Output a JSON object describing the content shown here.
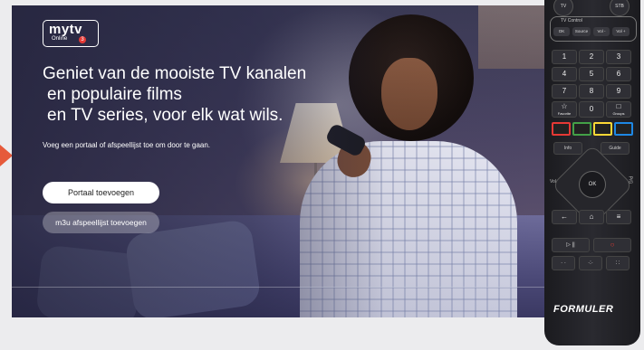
{
  "app": {
    "logo_text": "mytv",
    "logo_sub": "Online",
    "logo_badge": "3"
  },
  "hero": {
    "line1": "Geniet van de mooiste TV kanalen",
    "line2": "en populaire films",
    "line3": "en TV series, voor elk wat wils.",
    "subtext": "Voeg een portaal of afspeellijst toe om door te gaan."
  },
  "buttons": {
    "add_portal": "Portaal toevoegen",
    "add_m3u": "m3u afspeellijst toevoegen"
  },
  "remote": {
    "tv": "TV",
    "stb": "STB",
    "tv_control": "TV Control",
    "ok_small": "OK",
    "source": "Source",
    "vol_minus": "Vol -",
    "vol_plus": "Vol +",
    "keys": [
      "1",
      "2",
      "3",
      "4",
      "5",
      "6",
      "7",
      "8",
      "9",
      "☆",
      "0",
      "□"
    ],
    "favorite": "Favorite",
    "groups": "Groups",
    "info": "Info",
    "guide": "Guide",
    "ok": "OK",
    "vol": "Vol",
    "pg": "P/G",
    "back": "←",
    "home": "⌂",
    "menu": "≡",
    "play_pause": "▷ ||",
    "rec": "○",
    "brand": "FORMULER"
  },
  "colors": {
    "accent_arrow": "#e65a3a",
    "red_key": "#e53935",
    "green_key": "#43a047",
    "yellow_key": "#fdd835",
    "blue_key": "#1e88e5"
  }
}
